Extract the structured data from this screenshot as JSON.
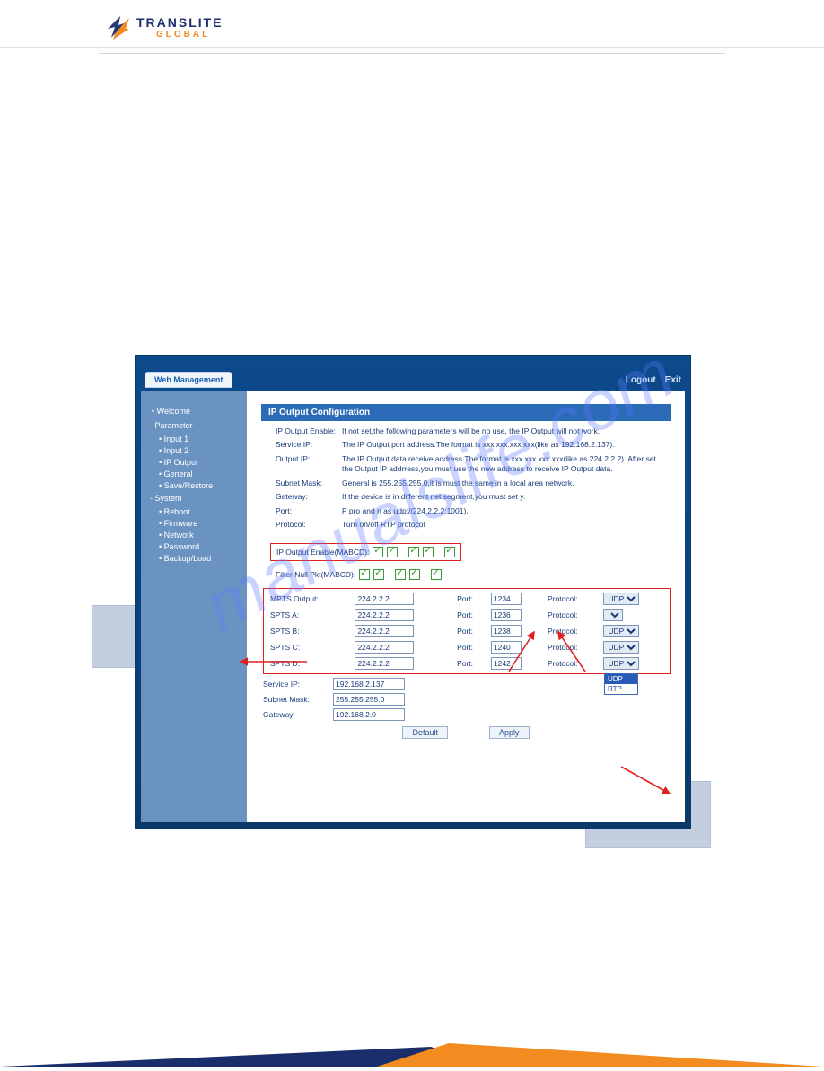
{
  "logo": {
    "line1": "TRANSLITE",
    "line2": "GLOBAL"
  },
  "watermark": "manualslife.com",
  "topbar": {
    "tab": "Web Management",
    "logout": "Logout",
    "exit": "Exit"
  },
  "sidebar": {
    "welcome": "Welcome",
    "parameter": "Parameter",
    "parameter_items": [
      "Input 1",
      "Input 2",
      "IP Output",
      "General",
      "Save/Restore"
    ],
    "system": "System",
    "system_items": [
      "Reboot",
      "Firmware",
      "Network",
      "Password",
      "Backup/Load"
    ]
  },
  "panel": {
    "title": "IP Output Configuration"
  },
  "desc": [
    {
      "label": "IP Output Enable:",
      "text": "If not set,the following parameters will be no use, the IP Output will not work."
    },
    {
      "label": "Service IP:",
      "text": "The IP Output port address.The format is xxx.xxx.xxx.xxx(like as 192.168.2.137)."
    },
    {
      "label": "Output IP:",
      "text": "The IP Output data receive address.The format is xxx.xxx.xxx.xxx(like as 224.2.2.2). After set the Output IP addrress,you must use the new address to receive IP Output data."
    },
    {
      "label": "Subnet Mask:",
      "text": "General is 255.255.255.0,it is must the same in a local area network."
    },
    {
      "label": "Gateway:",
      "text": "If the device is in different net segment,you must set y."
    },
    {
      "label": "Port:",
      "text": "P pro and n as udp://224.2.2.2:1001)."
    },
    {
      "label": "Protocol:",
      "text": "Turn on/off RTP protocol"
    }
  ],
  "enable_label": "IP Output Enable(MABCD):",
  "filter_label": "Filter Null Pkt(MABCD):",
  "columns": {
    "port": "Port:",
    "protocol": "Protocol:"
  },
  "rows": [
    {
      "name": "MPTS Output:",
      "ip": "224.2.2.2",
      "port": "1234",
      "proto": "UDP"
    },
    {
      "name": "SPTS A:",
      "ip": "224.2.2.2",
      "port": "1236",
      "proto": ""
    },
    {
      "name": "SPTS B:",
      "ip": "224.2.2.2",
      "port": "1238",
      "proto": "UDP"
    },
    {
      "name": "SPTS C:",
      "ip": "224.2.2.2",
      "port": "1240",
      "proto": "UDP"
    },
    {
      "name": "SPTS D:",
      "ip": "224.2.2.2",
      "port": "1242",
      "proto": "UDP"
    }
  ],
  "dropdown": {
    "opt1": "UDP",
    "opt2": "RTP"
  },
  "net": {
    "service_ip_label": "Service IP:",
    "service_ip": "192.168.2.137",
    "subnet_label": "Subnet Mask:",
    "subnet": "255.255.255.0",
    "gateway_label": "Gateway:",
    "gateway": "192.168.2.0"
  },
  "buttons": {
    "default": "Default",
    "apply": "Apply"
  }
}
